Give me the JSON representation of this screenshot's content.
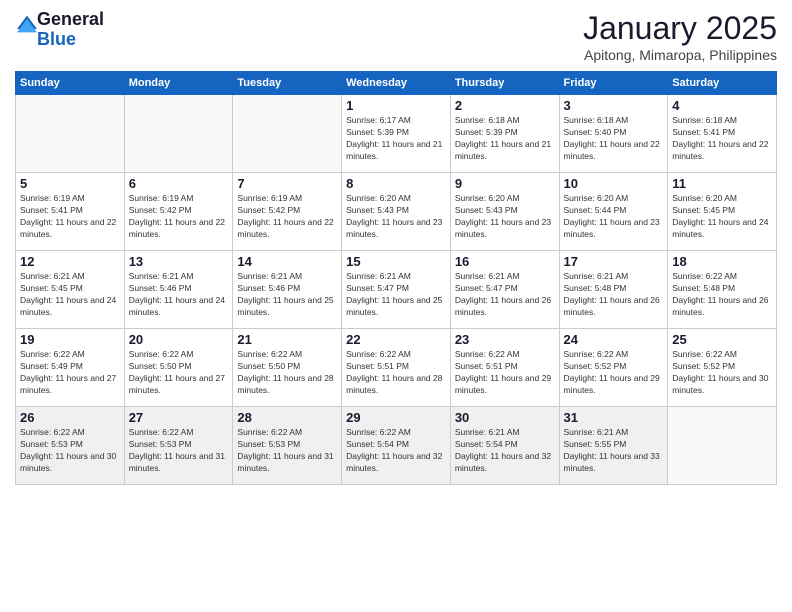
{
  "logo": {
    "general": "General",
    "blue": "Blue"
  },
  "header": {
    "month": "January 2025",
    "location": "Apitong, Mimaropa, Philippines"
  },
  "weekdays": [
    "Sunday",
    "Monday",
    "Tuesday",
    "Wednesday",
    "Thursday",
    "Friday",
    "Saturday"
  ],
  "weeks": [
    [
      {
        "day": "",
        "sunrise": "",
        "sunset": "",
        "daylight": ""
      },
      {
        "day": "",
        "sunrise": "",
        "sunset": "",
        "daylight": ""
      },
      {
        "day": "",
        "sunrise": "",
        "sunset": "",
        "daylight": ""
      },
      {
        "day": "1",
        "sunrise": "Sunrise: 6:17 AM",
        "sunset": "Sunset: 5:39 PM",
        "daylight": "Daylight: 11 hours and 21 minutes."
      },
      {
        "day": "2",
        "sunrise": "Sunrise: 6:18 AM",
        "sunset": "Sunset: 5:39 PM",
        "daylight": "Daylight: 11 hours and 21 minutes."
      },
      {
        "day": "3",
        "sunrise": "Sunrise: 6:18 AM",
        "sunset": "Sunset: 5:40 PM",
        "daylight": "Daylight: 11 hours and 22 minutes."
      },
      {
        "day": "4",
        "sunrise": "Sunrise: 6:18 AM",
        "sunset": "Sunset: 5:41 PM",
        "daylight": "Daylight: 11 hours and 22 minutes."
      }
    ],
    [
      {
        "day": "5",
        "sunrise": "Sunrise: 6:19 AM",
        "sunset": "Sunset: 5:41 PM",
        "daylight": "Daylight: 11 hours and 22 minutes."
      },
      {
        "day": "6",
        "sunrise": "Sunrise: 6:19 AM",
        "sunset": "Sunset: 5:42 PM",
        "daylight": "Daylight: 11 hours and 22 minutes."
      },
      {
        "day": "7",
        "sunrise": "Sunrise: 6:19 AM",
        "sunset": "Sunset: 5:42 PM",
        "daylight": "Daylight: 11 hours and 22 minutes."
      },
      {
        "day": "8",
        "sunrise": "Sunrise: 6:20 AM",
        "sunset": "Sunset: 5:43 PM",
        "daylight": "Daylight: 11 hours and 23 minutes."
      },
      {
        "day": "9",
        "sunrise": "Sunrise: 6:20 AM",
        "sunset": "Sunset: 5:43 PM",
        "daylight": "Daylight: 11 hours and 23 minutes."
      },
      {
        "day": "10",
        "sunrise": "Sunrise: 6:20 AM",
        "sunset": "Sunset: 5:44 PM",
        "daylight": "Daylight: 11 hours and 23 minutes."
      },
      {
        "day": "11",
        "sunrise": "Sunrise: 6:20 AM",
        "sunset": "Sunset: 5:45 PM",
        "daylight": "Daylight: 11 hours and 24 minutes."
      }
    ],
    [
      {
        "day": "12",
        "sunrise": "Sunrise: 6:21 AM",
        "sunset": "Sunset: 5:45 PM",
        "daylight": "Daylight: 11 hours and 24 minutes."
      },
      {
        "day": "13",
        "sunrise": "Sunrise: 6:21 AM",
        "sunset": "Sunset: 5:46 PM",
        "daylight": "Daylight: 11 hours and 24 minutes."
      },
      {
        "day": "14",
        "sunrise": "Sunrise: 6:21 AM",
        "sunset": "Sunset: 5:46 PM",
        "daylight": "Daylight: 11 hours and 25 minutes."
      },
      {
        "day": "15",
        "sunrise": "Sunrise: 6:21 AM",
        "sunset": "Sunset: 5:47 PM",
        "daylight": "Daylight: 11 hours and 25 minutes."
      },
      {
        "day": "16",
        "sunrise": "Sunrise: 6:21 AM",
        "sunset": "Sunset: 5:47 PM",
        "daylight": "Daylight: 11 hours and 26 minutes."
      },
      {
        "day": "17",
        "sunrise": "Sunrise: 6:21 AM",
        "sunset": "Sunset: 5:48 PM",
        "daylight": "Daylight: 11 hours and 26 minutes."
      },
      {
        "day": "18",
        "sunrise": "Sunrise: 6:22 AM",
        "sunset": "Sunset: 5:48 PM",
        "daylight": "Daylight: 11 hours and 26 minutes."
      }
    ],
    [
      {
        "day": "19",
        "sunrise": "Sunrise: 6:22 AM",
        "sunset": "Sunset: 5:49 PM",
        "daylight": "Daylight: 11 hours and 27 minutes."
      },
      {
        "day": "20",
        "sunrise": "Sunrise: 6:22 AM",
        "sunset": "Sunset: 5:50 PM",
        "daylight": "Daylight: 11 hours and 27 minutes."
      },
      {
        "day": "21",
        "sunrise": "Sunrise: 6:22 AM",
        "sunset": "Sunset: 5:50 PM",
        "daylight": "Daylight: 11 hours and 28 minutes."
      },
      {
        "day": "22",
        "sunrise": "Sunrise: 6:22 AM",
        "sunset": "Sunset: 5:51 PM",
        "daylight": "Daylight: 11 hours and 28 minutes."
      },
      {
        "day": "23",
        "sunrise": "Sunrise: 6:22 AM",
        "sunset": "Sunset: 5:51 PM",
        "daylight": "Daylight: 11 hours and 29 minutes."
      },
      {
        "day": "24",
        "sunrise": "Sunrise: 6:22 AM",
        "sunset": "Sunset: 5:52 PM",
        "daylight": "Daylight: 11 hours and 29 minutes."
      },
      {
        "day": "25",
        "sunrise": "Sunrise: 6:22 AM",
        "sunset": "Sunset: 5:52 PM",
        "daylight": "Daylight: 11 hours and 30 minutes."
      }
    ],
    [
      {
        "day": "26",
        "sunrise": "Sunrise: 6:22 AM",
        "sunset": "Sunset: 5:53 PM",
        "daylight": "Daylight: 11 hours and 30 minutes."
      },
      {
        "day": "27",
        "sunrise": "Sunrise: 6:22 AM",
        "sunset": "Sunset: 5:53 PM",
        "daylight": "Daylight: 11 hours and 31 minutes."
      },
      {
        "day": "28",
        "sunrise": "Sunrise: 6:22 AM",
        "sunset": "Sunset: 5:53 PM",
        "daylight": "Daylight: 11 hours and 31 minutes."
      },
      {
        "day": "29",
        "sunrise": "Sunrise: 6:22 AM",
        "sunset": "Sunset: 5:54 PM",
        "daylight": "Daylight: 11 hours and 32 minutes."
      },
      {
        "day": "30",
        "sunrise": "Sunrise: 6:21 AM",
        "sunset": "Sunset: 5:54 PM",
        "daylight": "Daylight: 11 hours and 32 minutes."
      },
      {
        "day": "31",
        "sunrise": "Sunrise: 6:21 AM",
        "sunset": "Sunset: 5:55 PM",
        "daylight": "Daylight: 11 hours and 33 minutes."
      },
      {
        "day": "",
        "sunrise": "",
        "sunset": "",
        "daylight": ""
      }
    ]
  ]
}
